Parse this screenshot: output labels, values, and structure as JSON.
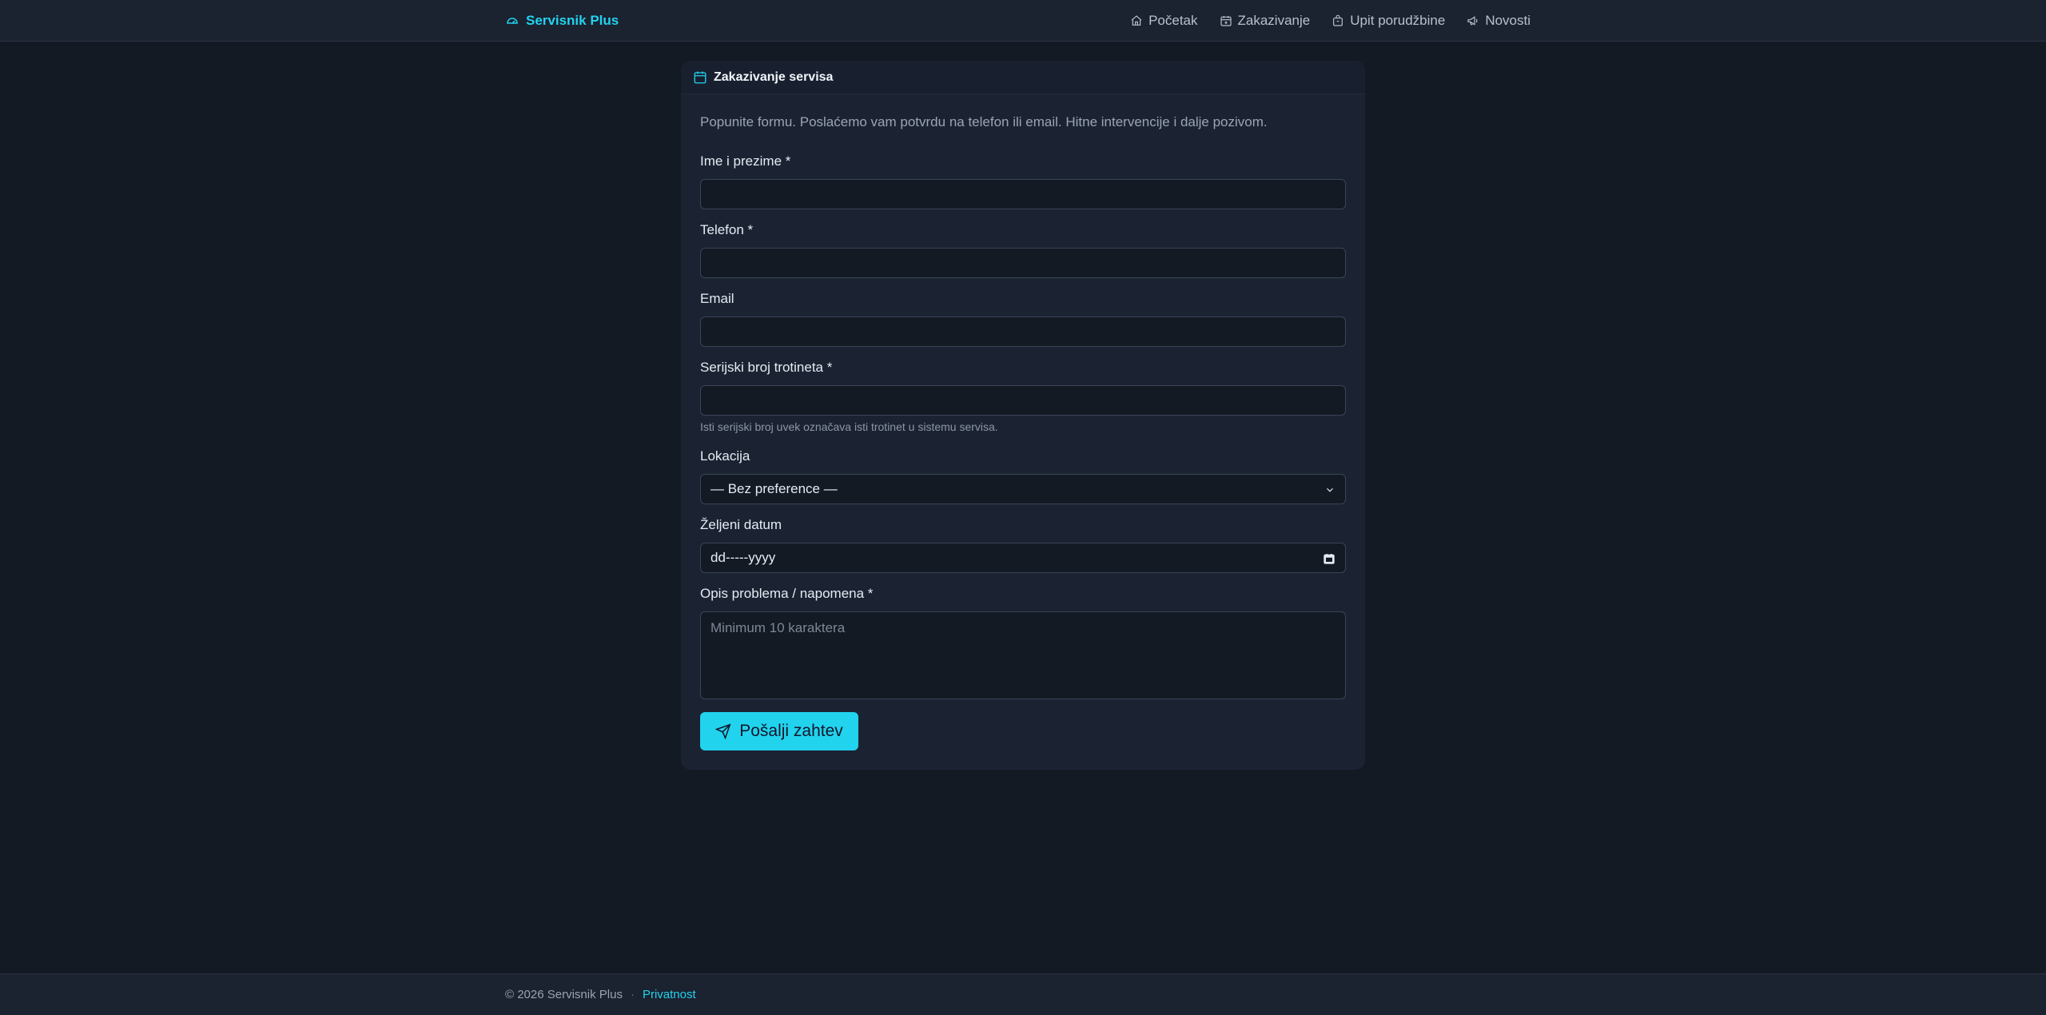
{
  "brand": {
    "name": "Servisnik Plus",
    "icon": "gauge-icon",
    "color": "#22d3ee"
  },
  "nav": [
    {
      "label": "Početak",
      "icon": "home-icon"
    },
    {
      "label": "Zakazivanje",
      "icon": "calendar-plus-icon"
    },
    {
      "label": "Upit porudžbine",
      "icon": "bag-icon"
    },
    {
      "label": "Novosti",
      "icon": "megaphone-icon"
    }
  ],
  "form": {
    "title": "Zakazivanje servisa",
    "intro": "Popunite formu. Poslaćemo vam potvrdu na telefon ili email. Hitne intervencije i dalje pozivom.",
    "name_label": "Ime i prezime *",
    "phone_label": "Telefon *",
    "email_label": "Email",
    "serial_label": "Serijski broj trotineta *",
    "serial_help": "Isti serijski broj uvek označava isti trotinet u sistemu servisa.",
    "location_label": "Lokacija",
    "location_value": "— Bez preference —",
    "date_label": "Željeni datum",
    "date_value": "dd-----yyyy",
    "desc_label": "Opis problema / napomena *",
    "desc_placeholder": "Minimum 10 karaktera",
    "submit_label": "Pošalji zahtev"
  },
  "footer": {
    "copyright": "© 2026 Servisnik Plus",
    "separator": "·",
    "privacy": "Privatnost"
  }
}
